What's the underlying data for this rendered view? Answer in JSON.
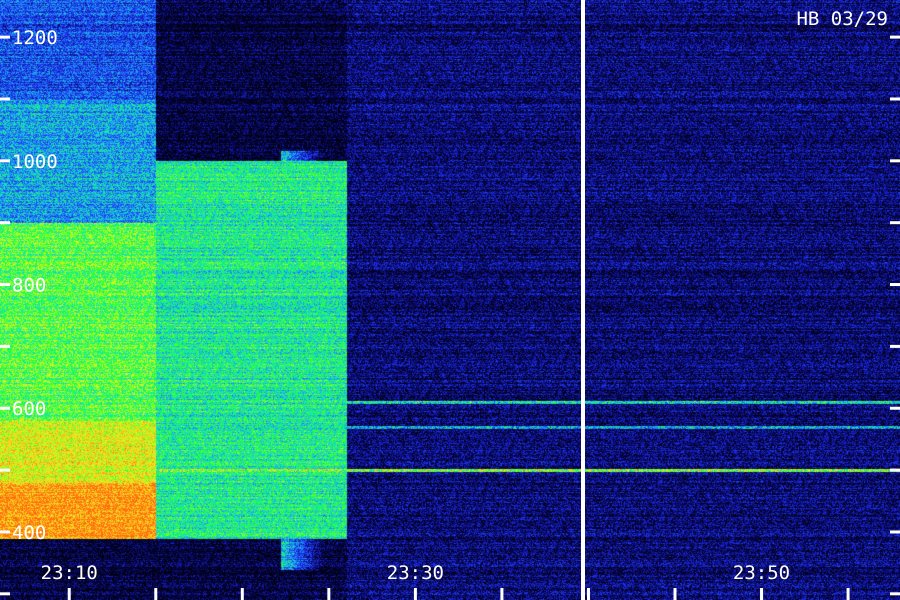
{
  "chart_data": {
    "type": "heatmap",
    "title": "HB 03/29",
    "xlabel": "",
    "ylabel": "",
    "y_axis": {
      "range": [
        290,
        1260
      ],
      "tick_labels": [
        "1200",
        "1000",
        "800",
        "600",
        "400"
      ],
      "tick_values": [
        1200,
        1000,
        800,
        600,
        400
      ],
      "minor_step": 100
    },
    "x_axis": {
      "range": [
        "23:06",
        "23:58"
      ],
      "tick_labels": [
        "23:10",
        "23:30",
        "23:50"
      ],
      "tick_values": [
        "23:10",
        "23:30",
        "23:50"
      ],
      "minor_step_minutes": 5
    },
    "colormap": [
      "#000010",
      "#0a0a6e",
      "#1c28e6",
      "#1e78ff",
      "#18e0c8",
      "#1cff3c",
      "#c8ff1e",
      "#ffd21e",
      "#ff6a10"
    ],
    "intensity_regions": [
      {
        "t_start": "23:06",
        "t_end": "23:15",
        "f_low": 390,
        "f_high": 480,
        "level": 0.95
      },
      {
        "t_start": "23:06",
        "t_end": "23:15",
        "f_low": 480,
        "f_high": 580,
        "level": 0.8
      },
      {
        "t_start": "23:06",
        "t_end": "23:15",
        "f_low": 580,
        "f_high": 900,
        "level": 0.65
      },
      {
        "t_start": "23:06",
        "t_end": "23:15",
        "f_low": 900,
        "f_high": 1100,
        "level": 0.42
      },
      {
        "t_start": "23:06",
        "t_end": "23:15",
        "f_low": 1100,
        "f_high": 1260,
        "level": 0.3
      },
      {
        "t_start": "23:15",
        "t_end": "23:26",
        "f_low": 390,
        "f_high": 1000,
        "level": 0.55
      },
      {
        "t_start": "23:26",
        "t_end": "23:58",
        "f_low": 290,
        "f_high": 1260,
        "level": 0.12
      }
    ],
    "emission_lines": [
      {
        "freq": 610,
        "level": 0.6
      },
      {
        "freq": 570,
        "level": 0.5
      },
      {
        "freq": 500,
        "level": 0.8
      }
    ],
    "data_gap": "23:42",
    "grid": false,
    "legend": "none"
  }
}
